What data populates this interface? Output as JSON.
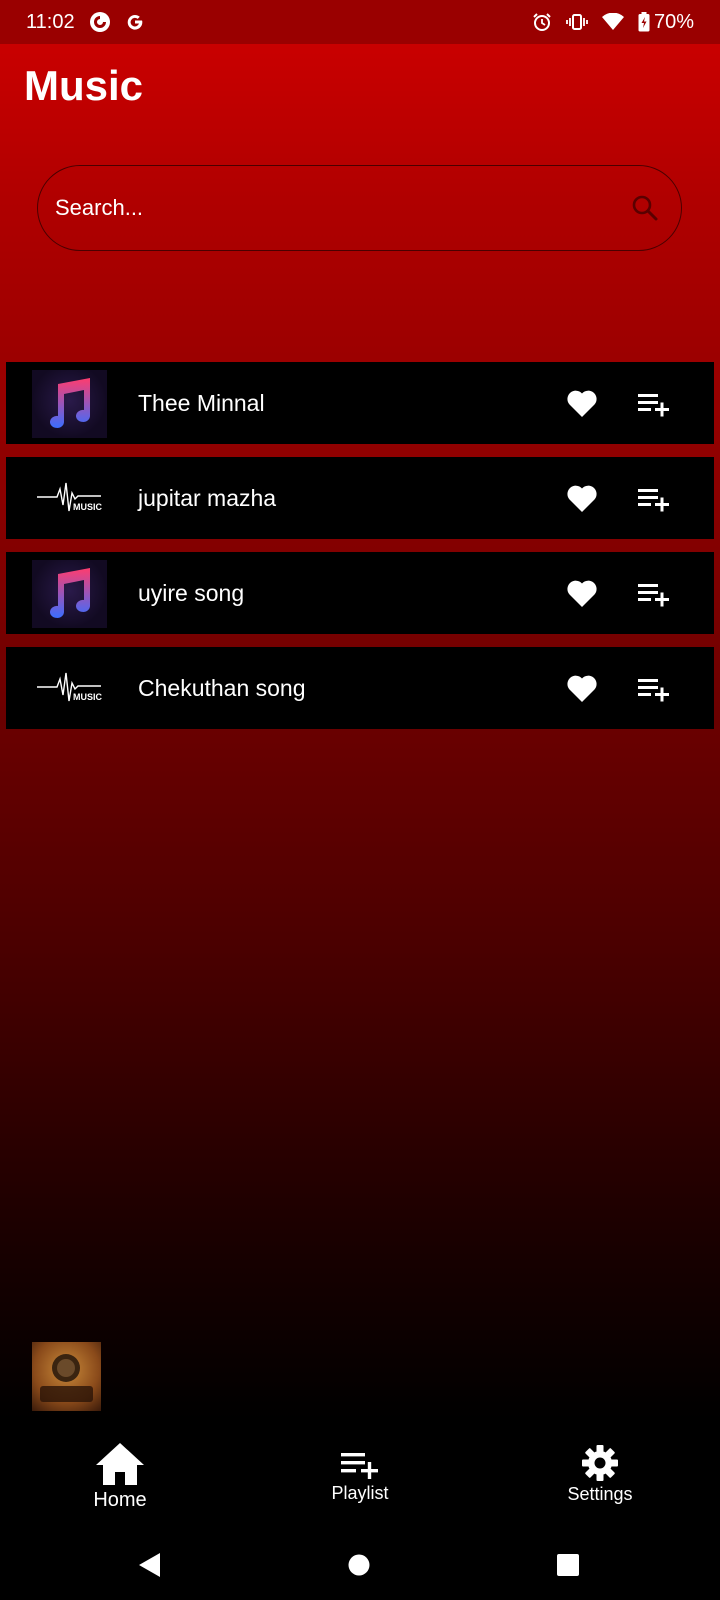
{
  "status_bar": {
    "time": "11:02",
    "battery": "70%",
    "left_icons": [
      "pocket-casts-icon",
      "google-icon"
    ],
    "right_icons": [
      "alarm-icon",
      "vibrate-icon",
      "wifi-icon",
      "battery-icon"
    ]
  },
  "header": {
    "title": "Music"
  },
  "search": {
    "placeholder": "Search..."
  },
  "songs": [
    {
      "title": "Thee Minnal",
      "art": "apple-music-art"
    },
    {
      "title": "jupitar mazha",
      "art": "music-wave-logo"
    },
    {
      "title": "uyire song",
      "art": "apple-music-art"
    },
    {
      "title": "Chekuthan song",
      "art": "music-wave-logo"
    }
  ],
  "art_text": {
    "music_logo": "MUSIC"
  },
  "nav": {
    "items": [
      {
        "label": "Home",
        "icon": "home-icon",
        "active": true
      },
      {
        "label": "Playlist",
        "icon": "playlist-add-icon",
        "active": false
      },
      {
        "label": "Settings",
        "icon": "gear-icon",
        "active": false
      }
    ]
  },
  "colors": {
    "accent": "#d00000",
    "row_background": "#000000",
    "text": "#ffffff"
  }
}
